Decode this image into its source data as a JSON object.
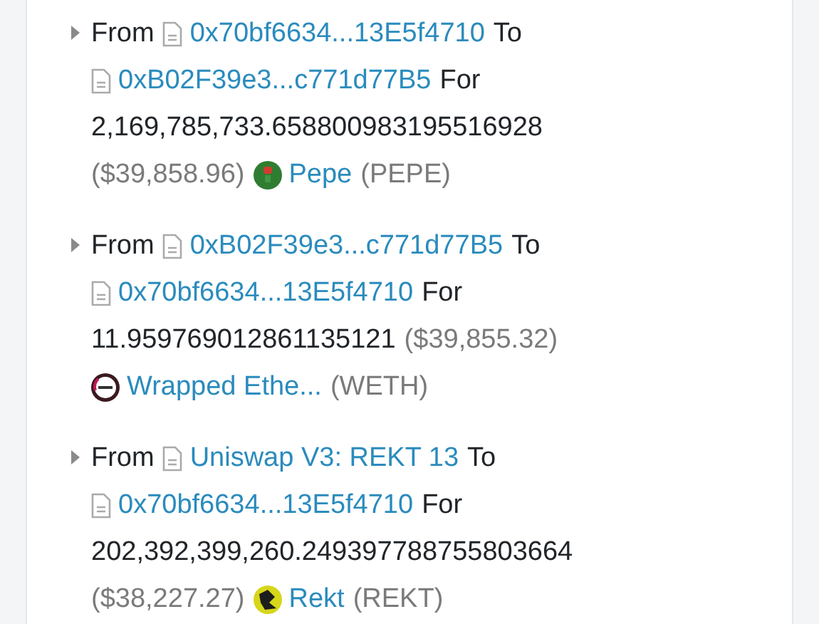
{
  "transfers": [
    {
      "from_word": "From",
      "from": "0x70bf6634...13E5f4710",
      "to_word": "To",
      "to": "0xB02F39e3...c771d77B5",
      "for_word": "For",
      "amount": "2,169,785,733.658800983195516928",
      "value": "($39,858.96)",
      "token_name": "Pepe",
      "token_symbol": "(PEPE)"
    },
    {
      "from_word": "From",
      "from": "0xB02F39e3...c771d77B5",
      "to_word": "To",
      "to": "0x70bf6634...13E5f4710",
      "for_word": "For",
      "amount": "11.959769012861135121",
      "value": "($39,855.32)",
      "token_name": "Wrapped Ethe...",
      "token_symbol": "(WETH)"
    },
    {
      "from_word": "From",
      "from": "Uniswap V3: REKT 13",
      "to_word": "To",
      "to": "0x70bf6634...13E5f4710",
      "for_word": "For",
      "amount": "202,392,399,260.249397788755803664",
      "value": "($38,227.27)",
      "token_name": "Rekt",
      "token_symbol": "(REKT)"
    }
  ]
}
